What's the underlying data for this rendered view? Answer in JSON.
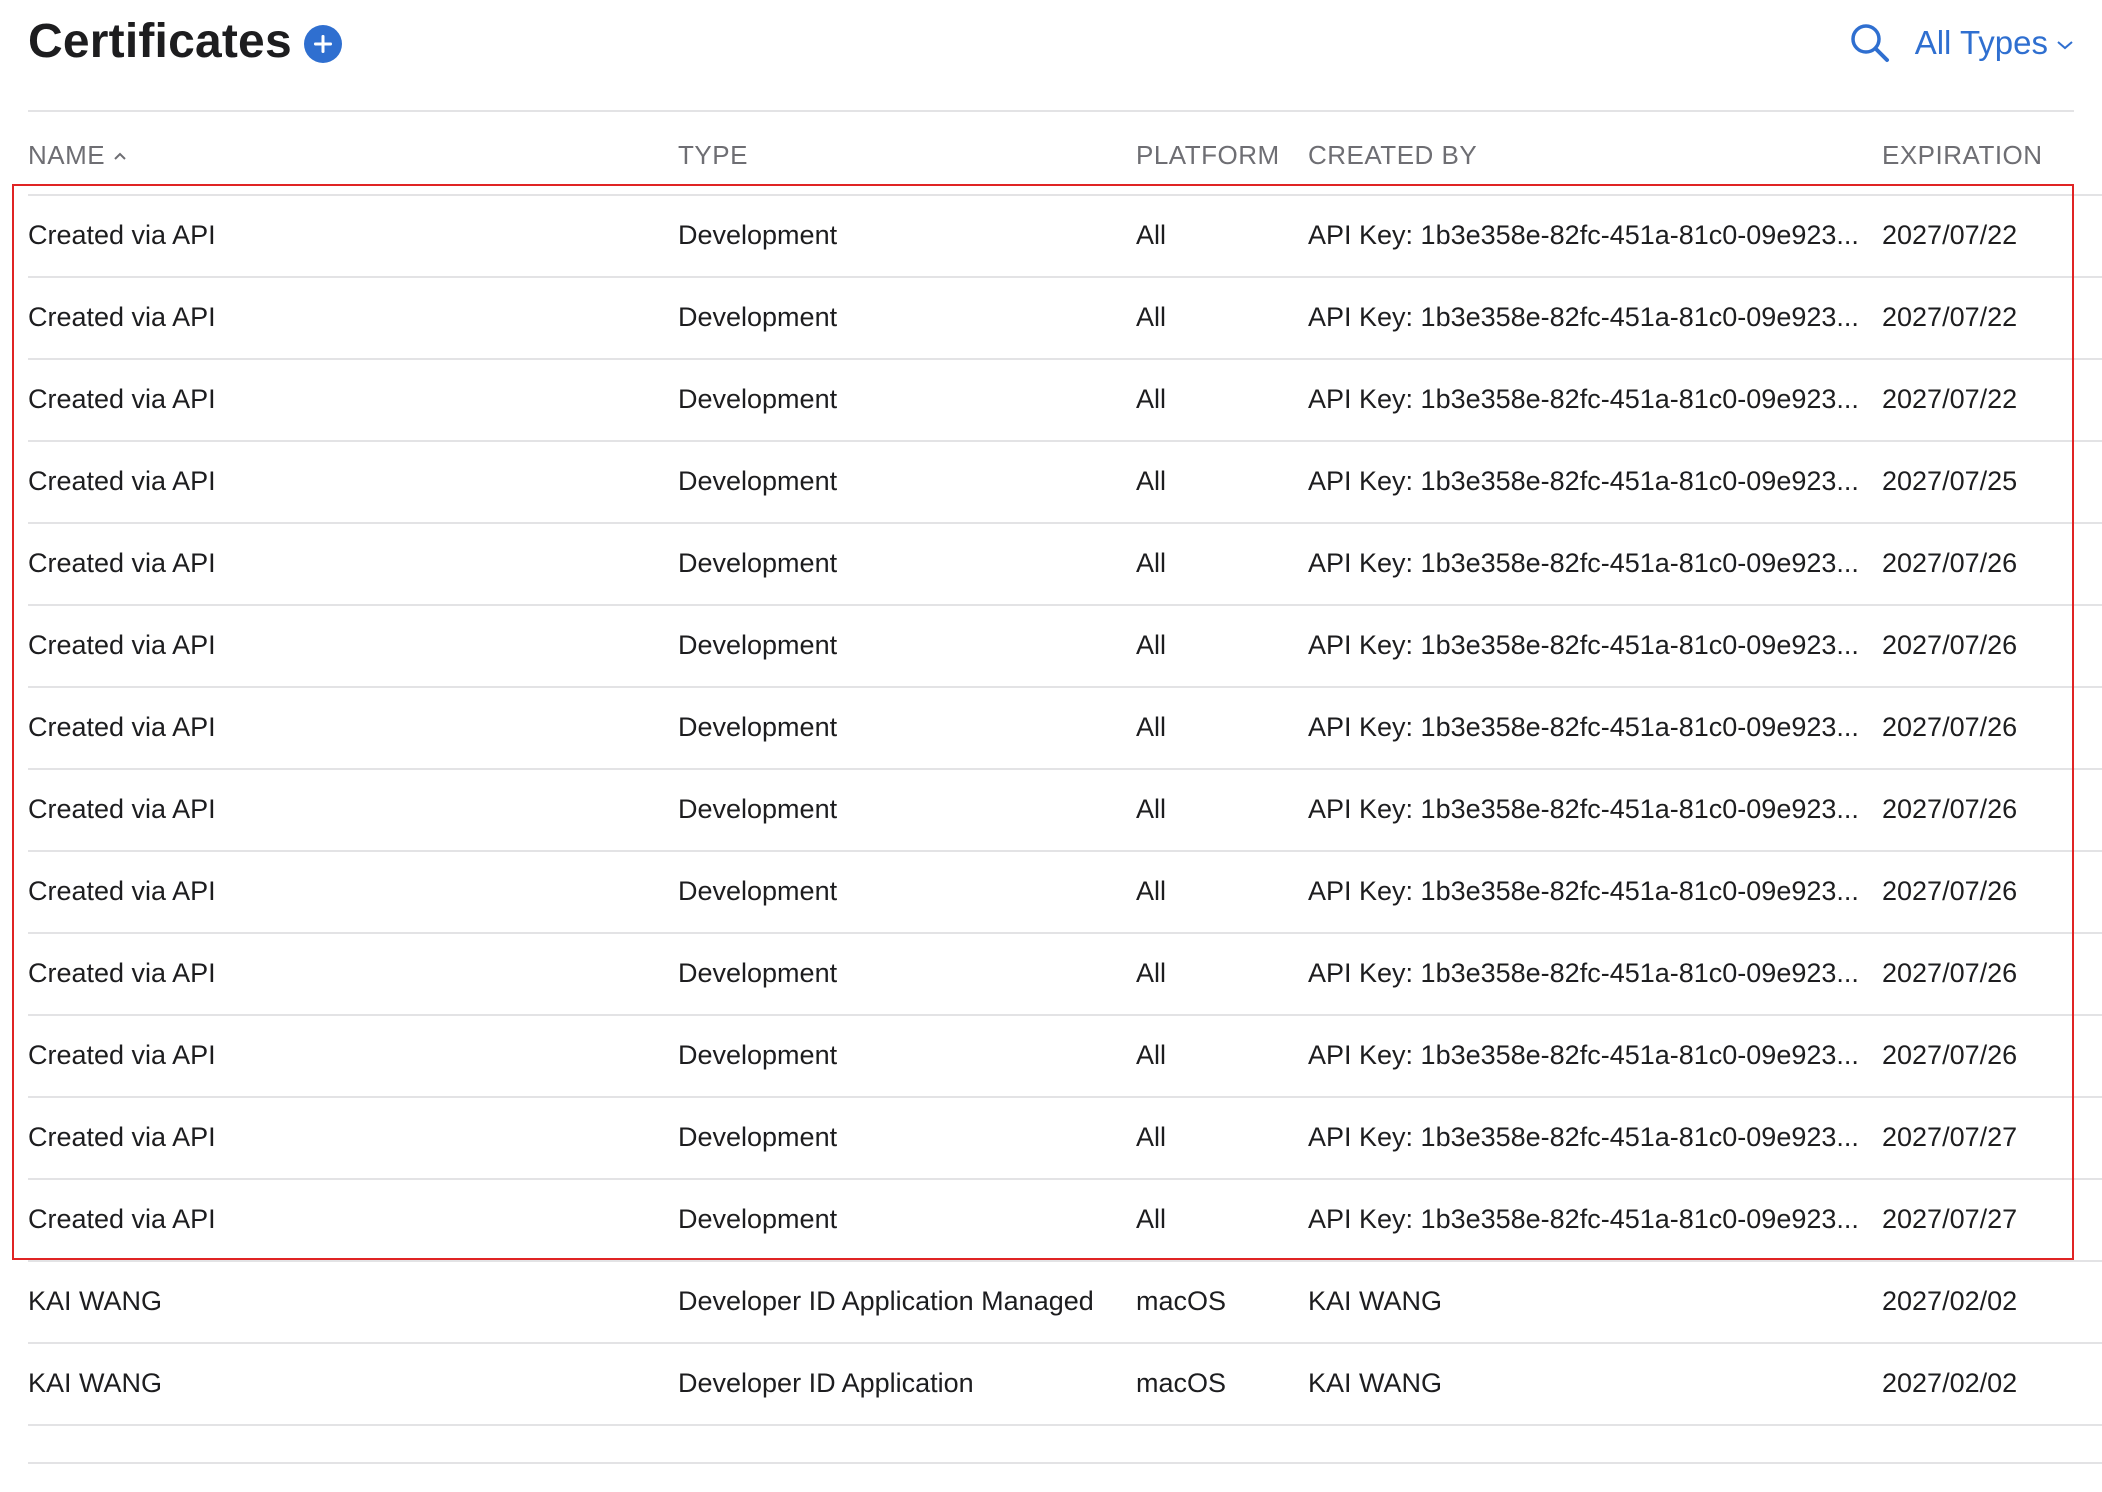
{
  "header": {
    "title": "Certificates",
    "filter_label": "All Types",
    "accent_color": "#2f6fd0",
    "icons": [
      "plus-circle-icon",
      "search-icon",
      "chevron-down-icon"
    ]
  },
  "table": {
    "columns": [
      "NAME",
      "TYPE",
      "PLATFORM",
      "CREATED BY",
      "EXPIRATION"
    ],
    "sort_column": "NAME",
    "rows": [
      {
        "name": "Created via API",
        "type": "Development",
        "platform": "All",
        "created_by": "API Key: 1b3e358e-82fc-451a-81c0-09e923...",
        "expiration": "2027/07/22"
      },
      {
        "name": "Created via API",
        "type": "Development",
        "platform": "All",
        "created_by": "API Key: 1b3e358e-82fc-451a-81c0-09e923...",
        "expiration": "2027/07/22"
      },
      {
        "name": "Created via API",
        "type": "Development",
        "platform": "All",
        "created_by": "API Key: 1b3e358e-82fc-451a-81c0-09e923...",
        "expiration": "2027/07/22"
      },
      {
        "name": "Created via API",
        "type": "Development",
        "platform": "All",
        "created_by": "API Key: 1b3e358e-82fc-451a-81c0-09e923...",
        "expiration": "2027/07/25"
      },
      {
        "name": "Created via API",
        "type": "Development",
        "platform": "All",
        "created_by": "API Key: 1b3e358e-82fc-451a-81c0-09e923...",
        "expiration": "2027/07/26"
      },
      {
        "name": "Created via API",
        "type": "Development",
        "platform": "All",
        "created_by": "API Key: 1b3e358e-82fc-451a-81c0-09e923...",
        "expiration": "2027/07/26"
      },
      {
        "name": "Created via API",
        "type": "Development",
        "platform": "All",
        "created_by": "API Key: 1b3e358e-82fc-451a-81c0-09e923...",
        "expiration": "2027/07/26"
      },
      {
        "name": "Created via API",
        "type": "Development",
        "platform": "All",
        "created_by": "API Key: 1b3e358e-82fc-451a-81c0-09e923...",
        "expiration": "2027/07/26"
      },
      {
        "name": "Created via API",
        "type": "Development",
        "platform": "All",
        "created_by": "API Key: 1b3e358e-82fc-451a-81c0-09e923...",
        "expiration": "2027/07/26"
      },
      {
        "name": "Created via API",
        "type": "Development",
        "platform": "All",
        "created_by": "API Key: 1b3e358e-82fc-451a-81c0-09e923...",
        "expiration": "2027/07/26"
      },
      {
        "name": "Created via API",
        "type": "Development",
        "platform": "All",
        "created_by": "API Key: 1b3e358e-82fc-451a-81c0-09e923...",
        "expiration": "2027/07/26"
      },
      {
        "name": "Created via API",
        "type": "Development",
        "platform": "All",
        "created_by": "API Key: 1b3e358e-82fc-451a-81c0-09e923...",
        "expiration": "2027/07/27"
      },
      {
        "name": "Created via API",
        "type": "Development",
        "platform": "All",
        "created_by": "API Key: 1b3e358e-82fc-451a-81c0-09e923...",
        "expiration": "2027/07/27"
      },
      {
        "name": "KAI WANG",
        "type": "Developer ID Application Managed",
        "platform": "macOS",
        "created_by": "KAI WANG",
        "expiration": "2027/02/02"
      },
      {
        "name": "KAI WANG",
        "type": "Developer ID Application",
        "platform": "macOS",
        "created_by": "KAI WANG",
        "expiration": "2027/02/02"
      }
    ]
  },
  "highlight_color": "#e02424"
}
